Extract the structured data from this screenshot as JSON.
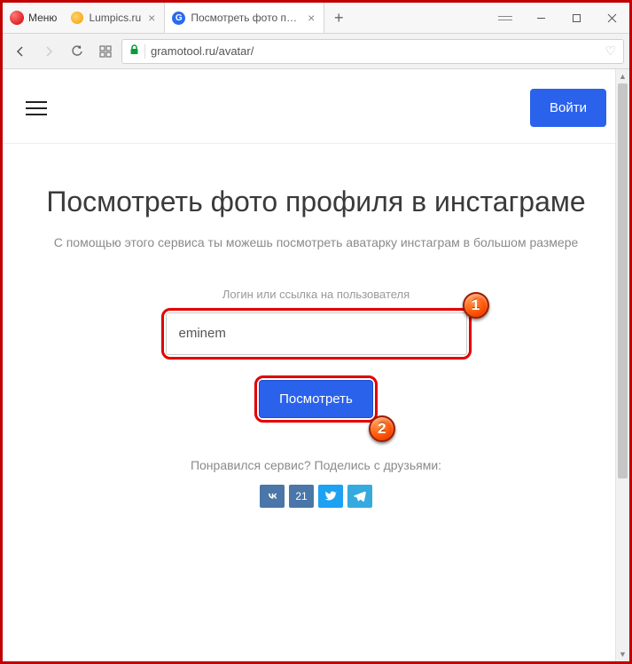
{
  "browser": {
    "menu_label": "Меню",
    "tabs": [
      {
        "title": "Lumpics.ru"
      },
      {
        "title": "Посмотреть фото профи"
      }
    ],
    "url": "gramotool.ru/avatar/"
  },
  "header": {
    "login_label": "Войти"
  },
  "hero": {
    "title": "Посмотреть фото профиля в инстаграме",
    "subtitle": "С помощью этого сервиса ты можешь посмотреть аватарку инстаграм в большом размере"
  },
  "form": {
    "label": "Логин или ссылка на пользователя",
    "input_value": "eminem",
    "submit_label": "Посмотреть"
  },
  "badges": {
    "one": "1",
    "two": "2"
  },
  "share": {
    "text": "Понравился сервис? Поделись с друзьями:",
    "vk_count": "21"
  }
}
